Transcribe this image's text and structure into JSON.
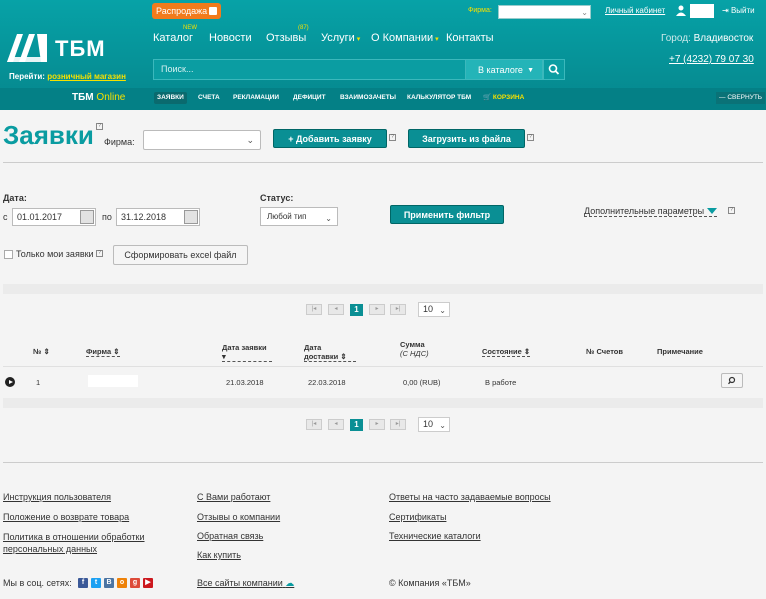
{
  "header": {
    "sale": "Распродажа",
    "firm_label": "Фирма:",
    "cabinet": "Личный кабинет",
    "exit": "Выйти",
    "goto_prefix": "Перейти:",
    "goto_link": "розничный магазин",
    "logo_text": "ТБМ",
    "nav": [
      {
        "label": "Каталог",
        "badge": "NEW"
      },
      {
        "label": "Новости"
      },
      {
        "label": "Отзывы",
        "badge": "(87)"
      },
      {
        "label": "Услуги"
      },
      {
        "label": "О Компании"
      },
      {
        "label": "Контакты"
      }
    ],
    "city_label": "Город:",
    "city": "Владивосток",
    "phone": "+7 (4232) 79 07 30",
    "search_placeholder": "Поиск...",
    "in_catalog": "В каталоге",
    "online_brand": "ТБМ",
    "online_suffix": "Online",
    "tabs": [
      "ЗАЯВКИ",
      "СЧЕТА",
      "РЕКЛАМАЦИИ",
      "ДЕФИЦИТ",
      "ВЗАИМОЗАЧЕТЫ",
      "КАЛЬКУЛЯТОР ТБМ",
      "КОРЗИНА"
    ],
    "collapse": "СВЕРНУТЬ"
  },
  "page": {
    "title": "Заявки",
    "firm_label": "Фирма:",
    "add_button": "+ Добавить заявку",
    "upload_button": "Загрузить из файла",
    "date_label": "Дата:",
    "from_label": "с",
    "to_label": "по",
    "date_from": "01.01.2017",
    "date_to": "31.12.2018",
    "status_label": "Статус:",
    "status_value": "Любой тип",
    "apply_button": "Применить фильтр",
    "more_params": "Дополнительные параметры",
    "only_mine": "Только мои заявки",
    "excel_button": "Сформировать excel файл"
  },
  "pager": {
    "current": "1",
    "page_size": "10"
  },
  "table": {
    "headers": {
      "num": "№",
      "firm": "Фирма",
      "date_req": "Дата заявки",
      "date_deliv": "Дата доставки",
      "sum": "Сумма",
      "sum_note": "(С НДС)",
      "state": "Состояние",
      "invoices": "№ Счетов",
      "note": "Примечание"
    },
    "rows": [
      {
        "num": "1",
        "date_req": "21.03.2018",
        "date_deliv": "22.03.2018",
        "sum": "0,00 (RUB)",
        "state": "В работе"
      }
    ]
  },
  "footer": {
    "col1": [
      "Инструкция пользователя",
      "Положение о возврате товара",
      "Политика в отношении обработки персональных данных"
    ],
    "col2": [
      "С Вами работают",
      "Отзывы о компании",
      "Обратная связь",
      "Как купить"
    ],
    "col3": [
      "Ответы на часто задаваемые вопросы",
      "Сертификаты",
      "Технические каталоги"
    ],
    "social_label": "Мы в соц. сетях:",
    "all_sites": "Все сайты компании",
    "copyright": "© Компания «ТБМ»"
  },
  "colors": {
    "brand": "#0a9ca1",
    "accent": "#f5e000",
    "sale": "#f27b1c"
  }
}
